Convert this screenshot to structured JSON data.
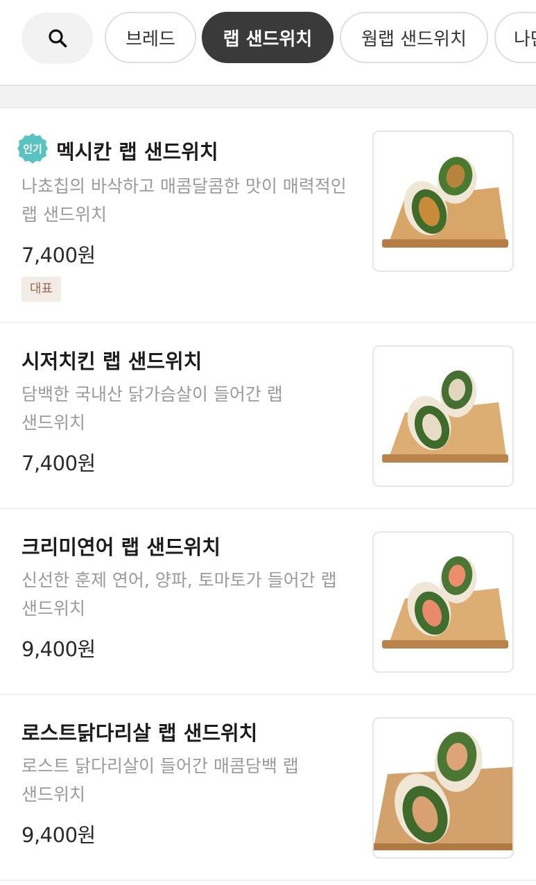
{
  "tabs": {
    "search_icon": "search-icon",
    "items": [
      {
        "label": "브레드",
        "active": false
      },
      {
        "label": "랩 샌드위치",
        "active": true
      },
      {
        "label": "웜랩 샌드위치",
        "active": false
      },
      {
        "label": "나만",
        "active": false
      }
    ]
  },
  "menu": [
    {
      "name": "멕시칸 랩 샌드위치",
      "popular_badge": "인기",
      "description": "나쵸칩의 바삭하고 매콤달콤한 맛이 매력적인 랩 샌드위치",
      "price": "7,400원",
      "tag": "대표",
      "image": "mexican-wrap-image"
    },
    {
      "name": "시저치킨 랩 샌드위치",
      "description": "담백한 국내산 닭가슴살이 들어간 랩 샌드위치",
      "price": "7,400원",
      "image": "caesar-chicken-wrap-image"
    },
    {
      "name": "크리미연어 랩 샌드위치",
      "description": "신선한 훈제 연어, 양파, 토마토가 들어간 랩 샌드위치",
      "price": "9,400원",
      "image": "creamy-salmon-wrap-image"
    },
    {
      "name": "로스트닭다리살 랩 샌드위치",
      "description": "로스트 닭다리살이 들어간 매콤담백 랩 샌드위치",
      "price": "9,400원",
      "image": "roast-chicken-thigh-wrap-image"
    }
  ],
  "colors": {
    "popular_badge": "#5bc3bf",
    "active_chip": "#3a3a3a",
    "tag_bg": "#f3ece6",
    "tag_text": "#9a6a4e"
  }
}
